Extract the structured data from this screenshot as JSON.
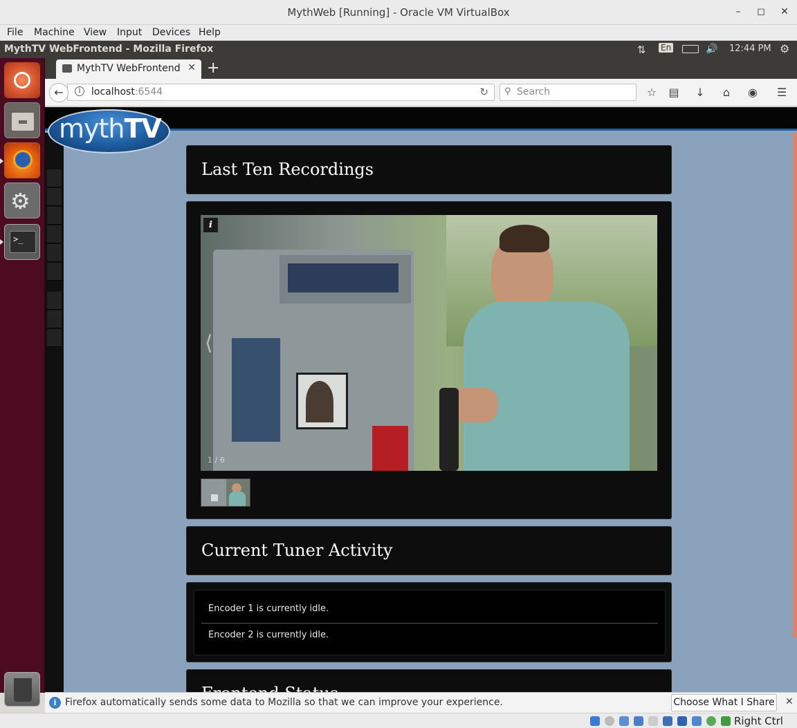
{
  "vbox": {
    "title": "MythWeb [Running] - Oracle VM VirtualBox",
    "menus": [
      "File",
      "Machine",
      "View",
      "Input",
      "Devices",
      "Help"
    ],
    "host_key": "Right Ctrl"
  },
  "ubuntu_panel": {
    "window_title": "MythTV WebFrontend - Mozilla Firefox",
    "keyboard_layout": "En",
    "time": "12:44 PM"
  },
  "firefox": {
    "tab_title": "MythTV WebFrontend",
    "url_host": "localhost",
    "url_port": ":6544",
    "search_placeholder": "Search",
    "notification_text": "Firefox automatically sends some data to Mozilla so that we can improve your experience.",
    "notification_button": "Choose What I Share"
  },
  "mythweb": {
    "logo_myth": "myth",
    "logo_tv": "TV",
    "recordings_title": "Last Ten Recordings",
    "slide_counter": "1 / 6",
    "tuner_title": "Current Tuner Activity",
    "tuners": [
      "Encoder 1 is currently idle.",
      "Encoder 2 is currently idle."
    ],
    "next_panel_title_partial": "Frontend Status"
  }
}
